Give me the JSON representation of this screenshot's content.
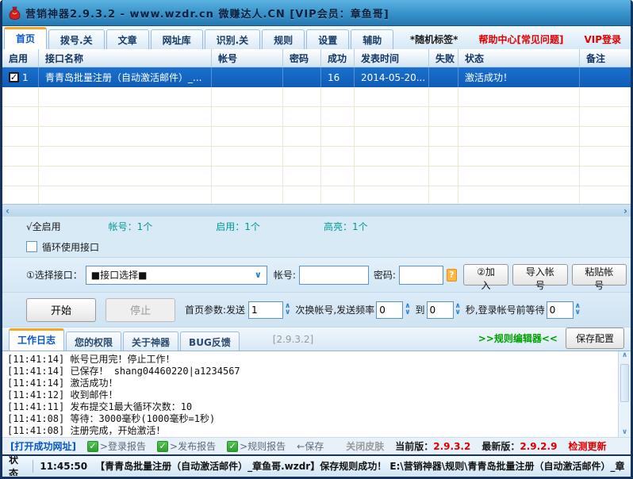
{
  "window": {
    "title": "营销神器2.9.3.2 - www.wzdr.cn 微赚达人.CN [VIP会员：章鱼哥]"
  },
  "tabs": {
    "items": [
      "首页",
      "拨号.关",
      "文章",
      "网址库",
      "识别.关",
      "规则",
      "设置",
      "辅助"
    ],
    "random_tag": "*随机标签*",
    "help_center": "帮助中心[常见问题]",
    "vip_login": "VIP登录"
  },
  "table": {
    "columns": [
      "启用",
      "接口名称",
      "帐号",
      "密码",
      "成功",
      "发表时间",
      "失败",
      "状态",
      "备注"
    ],
    "rows": [
      {
        "check": "✓",
        "index": "1",
        "name": "青青岛批量注册（自动激活邮件）_...",
        "account": "",
        "password": "",
        "success": "16",
        "publish_time": "2014-05-20...",
        "fail": "",
        "status": "激活成功！",
        "remark": ""
      }
    ],
    "hscroll_left": "‹",
    "hscroll_right": "›"
  },
  "summary": {
    "all_enable": "√全启用",
    "accounts": "帐号：1个",
    "enabled": "启用：1个",
    "highlight": "高亮：1个",
    "loop_label": "循环使用接口"
  },
  "interface_row": {
    "select_label": "①选择接口：",
    "select_value": "■接口选择■",
    "dd_chevron": "∨",
    "account_label": "帐号:",
    "password_label": "密码:",
    "help_icon": "?",
    "join_button": "②加入",
    "import_button": "导入帐号",
    "paste_button": "粘贴帐号"
  },
  "control_row": {
    "start_button": "开始",
    "stop_button": "停止",
    "label_send": "首页参数:发送",
    "send_value": "1",
    "label_freq": "次换帐号,发送频率",
    "freq_value": "0",
    "label_to": "到",
    "to_value": "0",
    "label_wait": "秒,登录帐号前等待",
    "wait_value": "0"
  },
  "log_tabs": {
    "items": [
      "工作日志",
      "您的权限",
      "关于神器",
      "BUG反馈"
    ],
    "version_label": "[2.9.3.2]",
    "rule_editor": ">>规则编辑器<<",
    "save_config": "保存配置"
  },
  "log": {
    "lines": [
      "[11:41:14] 帐号已用完！停止工作！",
      "[11:41:14] 已保存！  shang04460220|a1234567",
      "[11:41:14] 激活成功！",
      "[11:41:12] 收到邮件！",
      "[11:41:11] 发布提交1最大循环次数：10",
      "[11:41:08] 等待：3000毫秒(1000毫秒=1秒)",
      "[11:41:08] 注册完成，开始激活！"
    ]
  },
  "options_bar": {
    "open_success_url": "[打开成功网址]",
    "check": "✓",
    "login_report": ">登录报告",
    "publish_report": ">发布报告",
    "rule_report": ">规则报告",
    "save_arrow": "←保存",
    "close_skin": "关闭皮肤",
    "current_version_label": "当前版：",
    "current_version": "2.9.3.2",
    "latest_version_label": "最新版：",
    "latest_version": "2.9.2.9",
    "check_update": "检测更新"
  },
  "status_bar": {
    "label": "状态",
    "time": "11:45:50",
    "message": "【青青岛批量注册（自动激活邮件）_章鱼哥.wzdr】保存规则成功！ E:\\营销神器\\规则\\青青岛批量注册（自动激活邮件）_章鱼哥.wz"
  },
  "colors": {
    "accent_orange": "#f5a623",
    "selected_row_blue": "#1165c5",
    "alert_red": "#e00000",
    "teal_info": "#009898",
    "green_ok": "#00a000"
  }
}
